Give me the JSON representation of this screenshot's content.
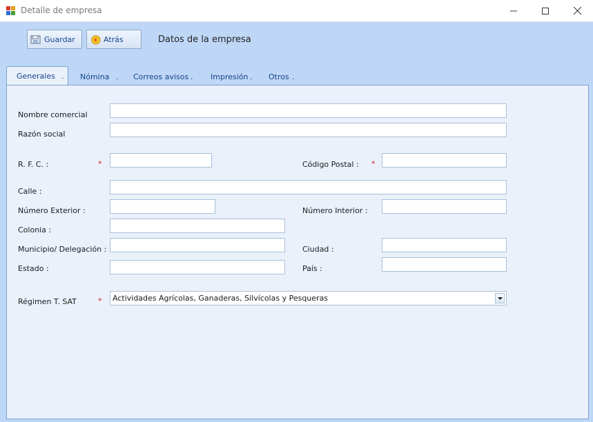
{
  "window": {
    "title": "Detalle de empresa"
  },
  "toolbar": {
    "save_label": "Guardar",
    "back_label": "Atrás",
    "header_title": "Datos de la empresa"
  },
  "tabs": [
    {
      "label": "Generales",
      "suffix": "."
    },
    {
      "label": "Nómina",
      "suffix": "."
    },
    {
      "label": "Correos avisos",
      "suffix": "."
    },
    {
      "label": "Impresión",
      "suffix": "."
    },
    {
      "label": "Otros",
      "suffix": "."
    }
  ],
  "form": {
    "nombre_comercial": {
      "label": "Nombre comercial",
      "value": ""
    },
    "razon_social": {
      "label": "Razón social",
      "value": ""
    },
    "rfc": {
      "label": "R. F. C.  :",
      "required_mark": "*",
      "value": ""
    },
    "codigo_postal": {
      "label": "Código Postal :",
      "required_mark": "*",
      "value": ""
    },
    "calle": {
      "label": "Calle :",
      "value": ""
    },
    "numero_exterior": {
      "label": "Número Exterior :",
      "value": ""
    },
    "numero_interior": {
      "label": "Número Interior :",
      "value": ""
    },
    "colonia": {
      "label": "Colonia :",
      "value": ""
    },
    "municipio": {
      "label": "Municipio/ Delegación :",
      "value": ""
    },
    "ciudad": {
      "label": "Ciudad :",
      "value": ""
    },
    "estado": {
      "label": "Estado :",
      "value": ""
    },
    "pais": {
      "label": "País :",
      "value": ""
    },
    "regimen": {
      "label": "Régimen T. SAT",
      "required_mark": "*",
      "selected": "Actividades Agrícolas, Ganaderas, Silvícolas y Pesqueras"
    }
  },
  "colors": {
    "accent": "#15428b",
    "required": "#cc2222",
    "background": "#bfd7f7",
    "panel": "#eaf1fb"
  }
}
